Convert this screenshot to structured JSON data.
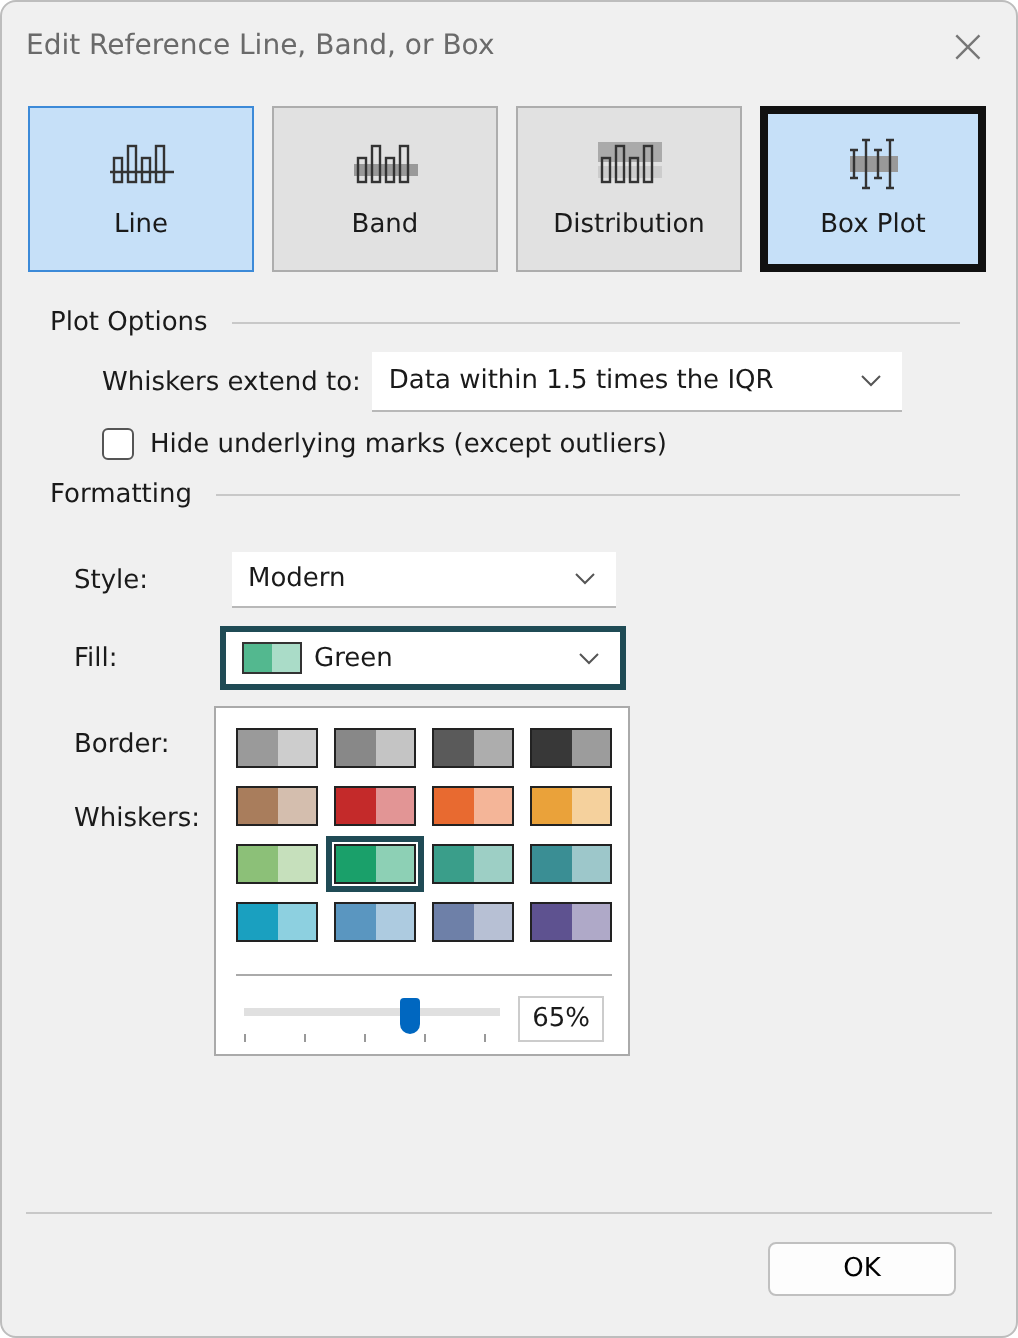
{
  "window": {
    "title": "Edit Reference Line, Band, or Box",
    "close": "×"
  },
  "types": [
    {
      "label": "Line",
      "kind": "line",
      "selected": false,
      "hover": true
    },
    {
      "label": "Band",
      "kind": "band",
      "selected": false,
      "hover": false
    },
    {
      "label": "Distribution",
      "kind": "distribution",
      "selected": false,
      "hover": false
    },
    {
      "label": "Box Plot",
      "kind": "boxplot",
      "selected": true,
      "hover": false
    }
  ],
  "plot_options": {
    "heading": "Plot Options",
    "whiskers_label": "Whiskers extend to:",
    "whiskers_value": "Data within 1.5 times the IQR",
    "hide_marks": {
      "label": "Hide underlying marks (except outliers)",
      "checked": false
    }
  },
  "formatting": {
    "heading": "Formatting",
    "style_label": "Style:",
    "style_value": "Modern",
    "fill_label": "Fill:",
    "fill_value": "Green",
    "border_label": "Border:",
    "whiskers_label": "Whiskers:"
  },
  "palette": {
    "swatches": [
      {
        "color": "#9a9a9a",
        "selected": false
      },
      {
        "color": "#888888",
        "selected": false
      },
      {
        "color": "#5a5a5a",
        "selected": false
      },
      {
        "color": "#383838",
        "selected": false
      },
      {
        "color": "#a97d5c",
        "selected": false
      },
      {
        "color": "#c42a2a",
        "selected": false
      },
      {
        "color": "#e86a30",
        "selected": false
      },
      {
        "color": "#eaa23a",
        "selected": false
      },
      {
        "color": "#8cc078",
        "selected": false
      },
      {
        "color": "#1aa06a",
        "selected": true
      },
      {
        "color": "#3a9e8a",
        "selected": false
      },
      {
        "color": "#3a8e94",
        "selected": false
      },
      {
        "color": "#1aa0c0",
        "selected": false
      },
      {
        "color": "#5a96c0",
        "selected": false
      },
      {
        "color": "#6e80a8",
        "selected": false
      },
      {
        "color": "#5e5290",
        "selected": false
      }
    ],
    "opacity": {
      "level": 0.65,
      "reading": "65%"
    }
  },
  "buttons": [
    "OK"
  ]
}
